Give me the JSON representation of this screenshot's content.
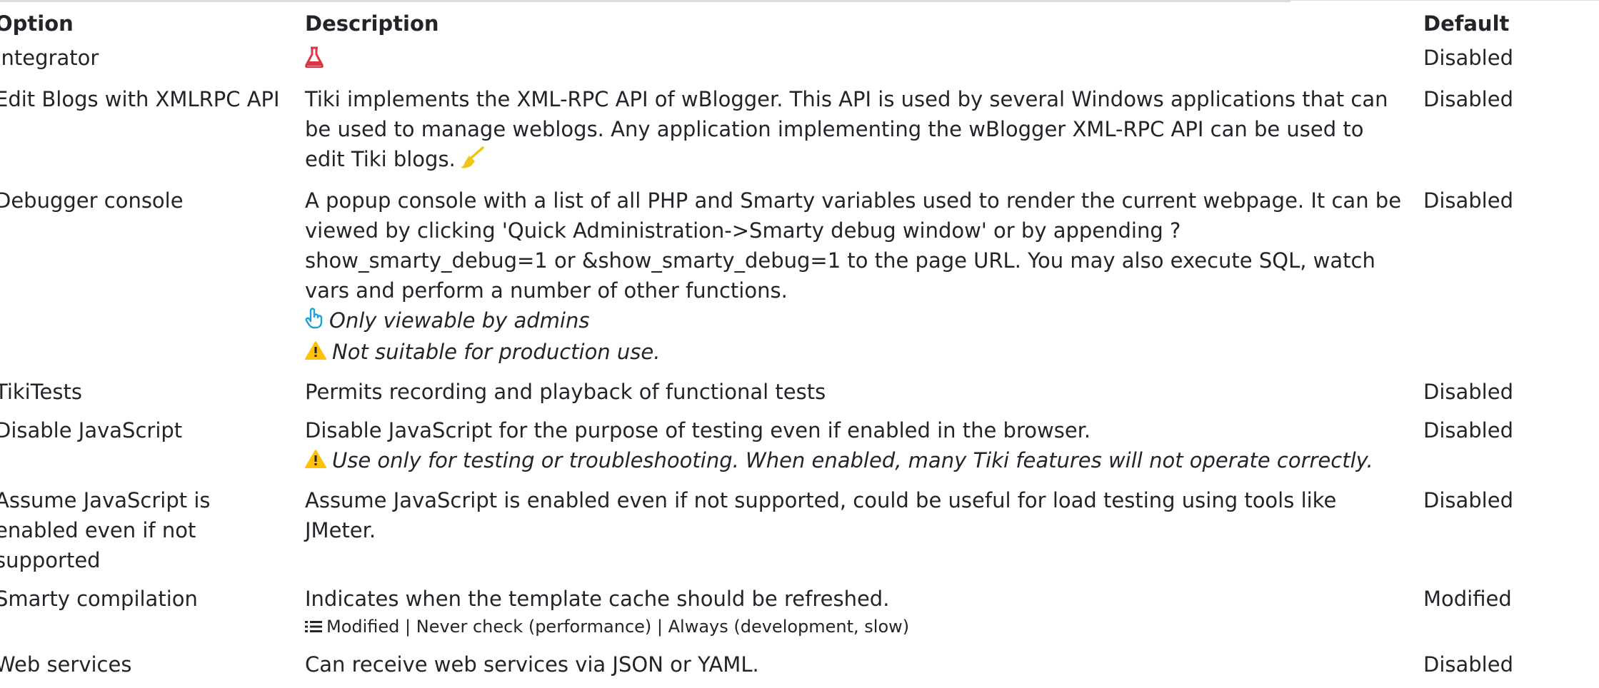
{
  "headers": {
    "option": "Option",
    "description": "Description",
    "default": "Default"
  },
  "rows": [
    {
      "option": "Integrator",
      "description": "",
      "default": "Disabled",
      "icon": "flask-icon"
    },
    {
      "option": "Edit Blogs with XMLRPC API",
      "description": "Tiki implements the XML-RPC API of wBlogger. This API is used by several Windows applications that can be used to manage weblogs. Any application implementing the wBlogger XML-RPC API can be used to edit Tiki blogs.",
      "default": "Disabled",
      "icon": "broom-icon"
    },
    {
      "option": "Debugger console",
      "description": "A popup console with a list of all PHP and Smarty variables used to render the current webpage. It can be viewed by clicking 'Quick Administration->Smarty debug window' or by appending ?show_smarty_debug=1 or &show_smarty_debug=1 to the page URL. You may also execute SQL, watch vars and perform a number of other functions.",
      "default": "Disabled",
      "note1": "Only viewable by admins",
      "note1_icon": "hand-pointer-icon",
      "note2": "Not suitable for production use.",
      "note2_icon": "warning-icon"
    },
    {
      "option": "TikiTests",
      "description": "Permits recording and playback of functional tests",
      "default": "Disabled"
    },
    {
      "option": "Disable JavaScript",
      "description": "Disable JavaScript for the purpose of testing even if enabled in the browser.",
      "default": "Disabled",
      "note1": "Use only for testing or troubleshooting. When enabled, many Tiki features will not operate correctly.",
      "note1_icon": "warning-icon"
    },
    {
      "option": "Assume JavaScript is enabled even if not supported",
      "description": "Assume JavaScript is enabled even if not supported, could be useful for load testing using tools like JMeter.",
      "default": "Disabled"
    },
    {
      "option": "Smarty compilation",
      "description": "Indicates when the template cache should be refreshed.",
      "default": "Modified",
      "options": "Modified | Never check (performance) | Always (development, slow)",
      "options_icon": "list-icon"
    },
    {
      "option": "Web services",
      "description": "Can receive web services via JSON or YAML.",
      "default": "Disabled"
    }
  ],
  "colors": {
    "text": "#212529",
    "flask": "#dc3545",
    "broom": "#f0c419",
    "warning": "#ffc107",
    "hand": "#17a2d8"
  }
}
